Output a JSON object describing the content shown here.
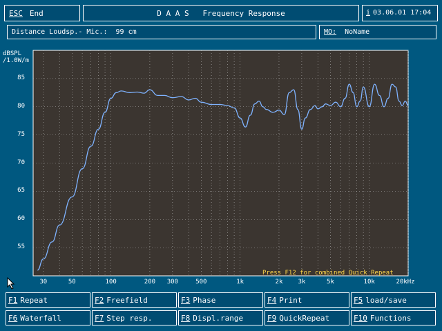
{
  "header": {
    "esc_key": "ESC",
    "esc_label": "End",
    "title": "D A A S   Frequency Response",
    "info_key": "i",
    "datetime": "03.06.01 17:04"
  },
  "infobar": {
    "distance": "Distance Loudsp.- Mic.:  99 cm",
    "mo_label": "MO:",
    "mo_value": "NoName"
  },
  "chart_data": {
    "type": "line",
    "ylabel": "dBSPL\n/1.0W/m",
    "ylabel_line1": "dBSPL",
    "ylabel_line2": "/1.0W/m",
    "x_scale": "log",
    "xlim": [
      25,
      20000
    ],
    "ylim": [
      50,
      90
    ],
    "x_ticks": [
      {
        "value": 30,
        "label": "30"
      },
      {
        "value": 50,
        "label": "50"
      },
      {
        "value": 100,
        "label": "100"
      },
      {
        "value": 200,
        "label": "200"
      },
      {
        "value": 300,
        "label": "300"
      },
      {
        "value": 500,
        "label": "500"
      },
      {
        "value": 1000,
        "label": "1k"
      },
      {
        "value": 2000,
        "label": "2k"
      },
      {
        "value": 3000,
        "label": "3k"
      },
      {
        "value": 5000,
        "label": "5k"
      },
      {
        "value": 10000,
        "label": "10k"
      },
      {
        "value": 20000,
        "label": "20kHz"
      }
    ],
    "y_ticks": [
      55,
      60,
      65,
      70,
      75,
      80,
      85
    ],
    "grid": true,
    "series": [
      {
        "color": "#7fb3ff",
        "x": [
          27,
          30,
          35,
          40,
          50,
          60,
          70,
          80,
          90,
          100,
          110,
          120,
          140,
          160,
          180,
          200,
          230,
          260,
          300,
          350,
          400,
          450,
          500,
          600,
          700,
          800,
          900,
          1000,
          1100,
          1200,
          1300,
          1400,
          1500,
          1600,
          1800,
          2000,
          2200,
          2400,
          2600,
          2800,
          3000,
          3200,
          3500,
          3800,
          4000,
          4300,
          4600,
          5000,
          5500,
          6000,
          6500,
          7000,
          7500,
          8000,
          8500,
          9000,
          10000,
          11000,
          12000,
          13000,
          14000,
          15000,
          16000,
          17000,
          18000,
          19000,
          20000
        ],
        "y": [
          51,
          53,
          56,
          59,
          64,
          69,
          73,
          76,
          79,
          81.5,
          82.5,
          82.8,
          82.5,
          82.6,
          82.4,
          83,
          82,
          82,
          81.6,
          81.8,
          81.2,
          81.5,
          80.8,
          80.4,
          80.4,
          80.2,
          79.8,
          78,
          76.4,
          78.5,
          80.5,
          81,
          80,
          79.5,
          79,
          79.4,
          78.6,
          82.5,
          83,
          79.5,
          76,
          78,
          79.5,
          80.2,
          79.6,
          80,
          80.5,
          80.2,
          80.8,
          80,
          81.5,
          84,
          82.5,
          80,
          81,
          83.5,
          80,
          84,
          82,
          80,
          81.5,
          84,
          83.5,
          81,
          80.2,
          81,
          80.2
        ]
      }
    ],
    "annotation": "Press F12 for combined Quick Repeat"
  },
  "fkeys": [
    {
      "key": "F1",
      "label": "Repeat"
    },
    {
      "key": "F2",
      "label": "Freefield"
    },
    {
      "key": "F3",
      "label": "Phase"
    },
    {
      "key": "F4",
      "label": "Print"
    },
    {
      "key": "F5",
      "label": "load/save"
    },
    {
      "key": "F6",
      "label": "Waterfall"
    },
    {
      "key": "F7",
      "label": "Step resp."
    },
    {
      "key": "F8",
      "label": "Displ.range"
    },
    {
      "key": "F9",
      "label": "QuickRepeat"
    },
    {
      "key": "F10",
      "label": "Functions"
    }
  ]
}
